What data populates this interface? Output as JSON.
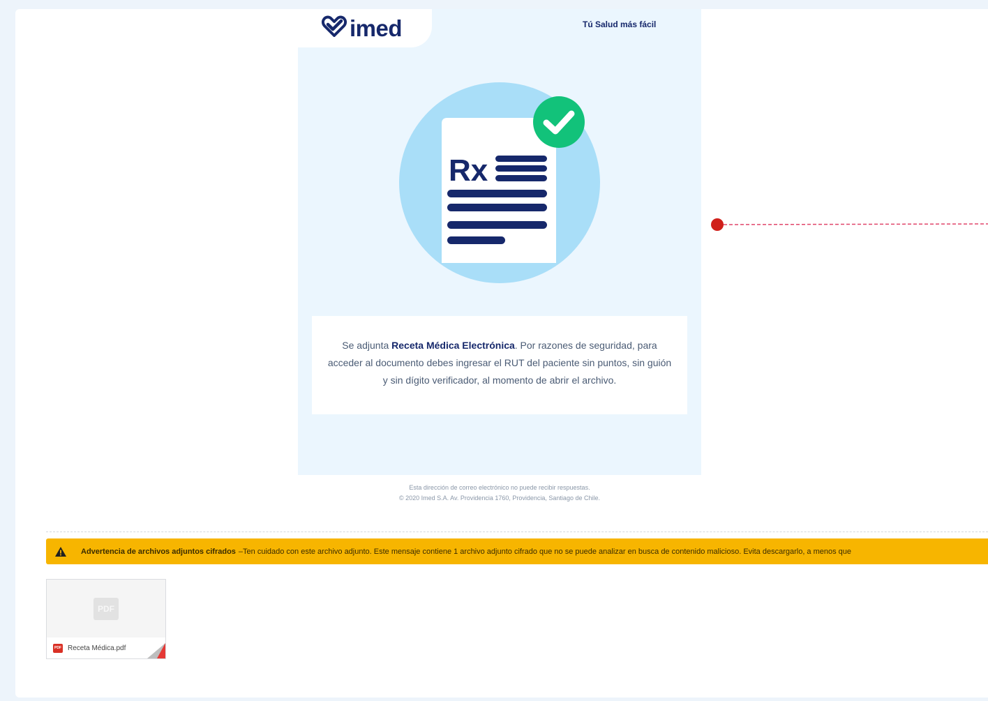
{
  "email": {
    "brand": "imed",
    "tagline": "Tú Salud más fácil",
    "hero_label": "Rx",
    "message": {
      "intro": "Se adjunta ",
      "highlight": "Receta Médica Electrónica",
      "body": ". Por razones de seguridad, para acceder al documento debes ingresar el RUT del paciente sin puntos, sin guión y sin dígito verificador, al momento de abrir el archivo."
    },
    "footer": {
      "line1": "Esta dirección de correo electrónico no puede recibir respuestas.",
      "line2": "© 2020 Imed S.A. Av. Providencia 1760, Providencia, Santiago de Chile."
    }
  },
  "warning": {
    "title": "Advertencia de archivos adjuntos cifrados",
    "separator": " – ",
    "text": "Ten cuidado con este archivo adjunto. Este mensaje contiene 1 archivo adjunto cifrado que no se puede analizar en busca de contenido malicioso. Evita descargarlo, a menos que"
  },
  "attachment": {
    "preview_label": "PDF",
    "badge": "PDF",
    "filename": "Receta Médica.pdf"
  },
  "icons": {
    "logo": "heart-check-icon",
    "hero": "prescription-document-icon",
    "check": "check-circle-icon",
    "warning": "warning-triangle-icon",
    "file": "pdf-icon"
  },
  "colors": {
    "brand_navy": "#16286b",
    "check_green": "#12c27a",
    "warning_bg": "#f7b500",
    "pdf_red": "#d93025",
    "email_bg": "#ebf6fe",
    "hero_circle": "#a9def8"
  }
}
